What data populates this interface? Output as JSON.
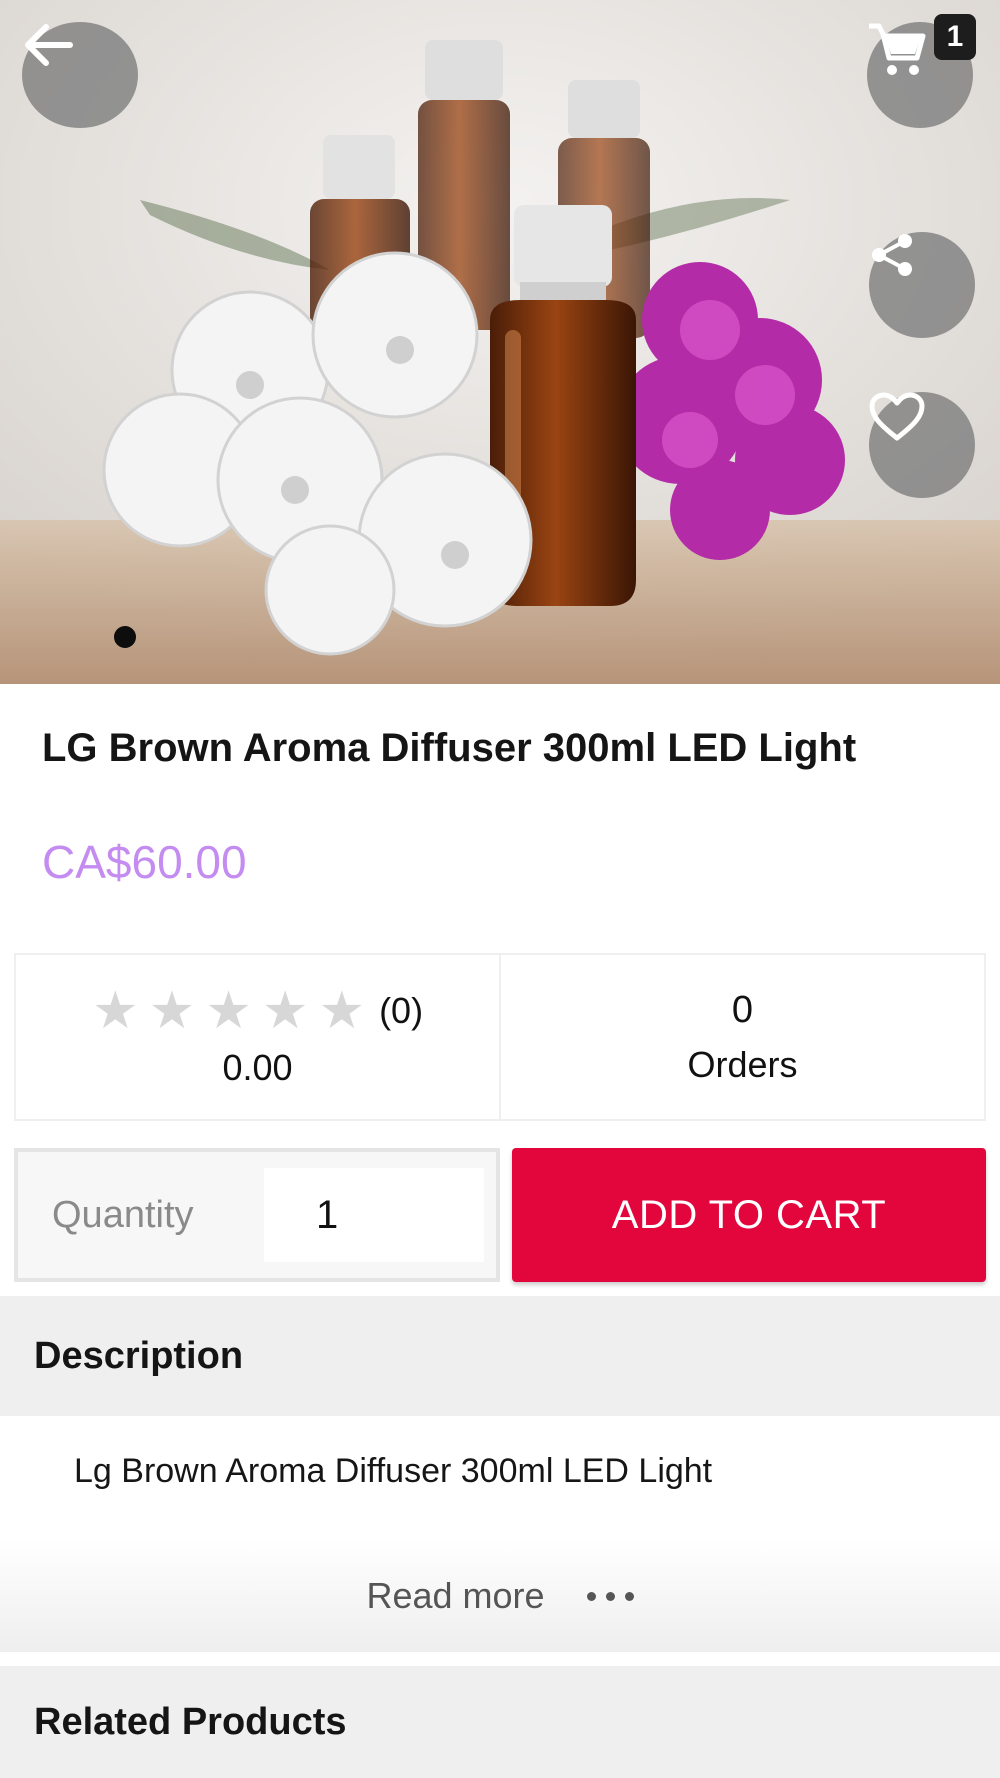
{
  "header": {
    "cart_badge": "1",
    "icons": {
      "back": "arrow-left-icon",
      "cart": "shopping-cart-icon",
      "share": "share-icon",
      "favorite": "heart-outline-icon"
    },
    "image_carousel": {
      "current": 1,
      "total": 1
    }
  },
  "product": {
    "title": "LG Brown Aroma Diffuser 300ml LED Light",
    "price": "CA$60.00",
    "price_color": "#c48cf0"
  },
  "stats": {
    "rating_stars": 0,
    "rating_max": 5,
    "rating_count": "(0)",
    "rating_value": "0.00",
    "orders_count": "0",
    "orders_label": "Orders"
  },
  "purchase": {
    "quantity_label": "Quantity",
    "quantity_value": "1",
    "add_to_cart_label": "ADD TO CART",
    "add_to_cart_color": "#e3063d"
  },
  "description": {
    "heading": "Description",
    "text": "Lg Brown Aroma Diffuser 300ml LED Light",
    "read_more": "Read more"
  },
  "related": {
    "heading": "Related Products"
  }
}
